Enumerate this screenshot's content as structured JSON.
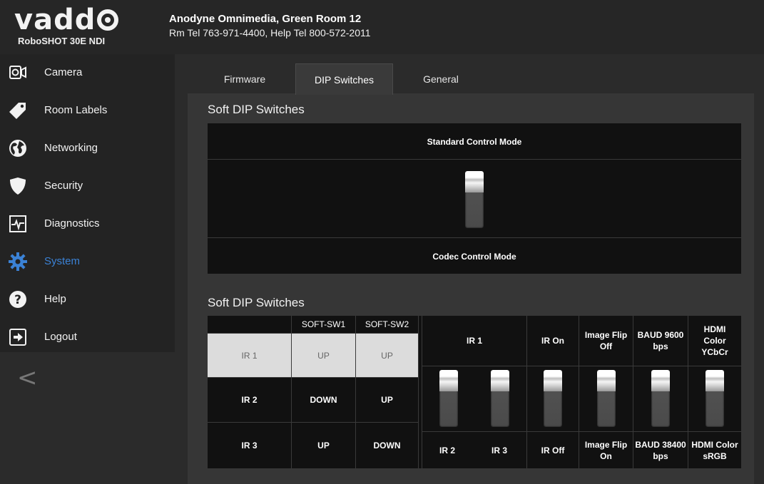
{
  "header": {
    "brand": "vadd",
    "model": "RoboSHOT 30E NDI",
    "location_line1": "Anodyne Omnimedia, Green Room 12",
    "location_line2": "Rm Tel 763-971-4400, Help Tel 800-572-2011"
  },
  "sidebar": {
    "items": [
      {
        "label": "Camera",
        "icon": "camera-icon"
      },
      {
        "label": "Room Labels",
        "icon": "tag-icon"
      },
      {
        "label": "Networking",
        "icon": "globe-icon"
      },
      {
        "label": "Security",
        "icon": "shield-icon"
      },
      {
        "label": "Diagnostics",
        "icon": "pulse-icon"
      },
      {
        "label": "System",
        "icon": "gear-icon",
        "active": true
      },
      {
        "label": "Help",
        "icon": "help-icon"
      },
      {
        "label": "Logout",
        "icon": "logout-icon"
      }
    ],
    "collapse_glyph": "<"
  },
  "tabs": [
    {
      "label": "Firmware"
    },
    {
      "label": "DIP Switches",
      "active": true
    },
    {
      "label": "General"
    }
  ],
  "section1": {
    "title": "Soft DIP Switches",
    "top_label": "Standard Control Mode",
    "bottom_label": "Codec Control Mode"
  },
  "section2": {
    "title": "Soft DIP Switches",
    "table": {
      "headers": [
        "",
        "SOFT-SW1",
        "SOFT-SW2"
      ],
      "rows": [
        {
          "name": "IR 1",
          "sw1": "UP",
          "sw2": "UP",
          "selected": true
        },
        {
          "name": "IR 2",
          "sw1": "DOWN",
          "sw2": "UP"
        },
        {
          "name": "IR 3",
          "sw1": "UP",
          "sw2": "DOWN"
        }
      ]
    },
    "switches": {
      "ir_top": "IR 1",
      "ir2_bottom": "IR 2",
      "ir3_bottom": "IR 3",
      "ir_on_top": "IR On",
      "ir_off_bottom": "IR Off",
      "flip_top": "Image Flip Off",
      "flip_bottom": "Image Flip On",
      "baud_top": "BAUD 9600 bps",
      "baud_bottom": "BAUD 38400 bps",
      "hdmi_top": "HDMI Color YCbCr",
      "hdmi_bottom": "HDMI Color sRGB"
    }
  },
  "colors": {
    "accent": "#3b82d6",
    "background": "#2b2b2b",
    "panel": "#363636",
    "table_bg": "#111111",
    "selected_row": "#dcdcdc"
  }
}
